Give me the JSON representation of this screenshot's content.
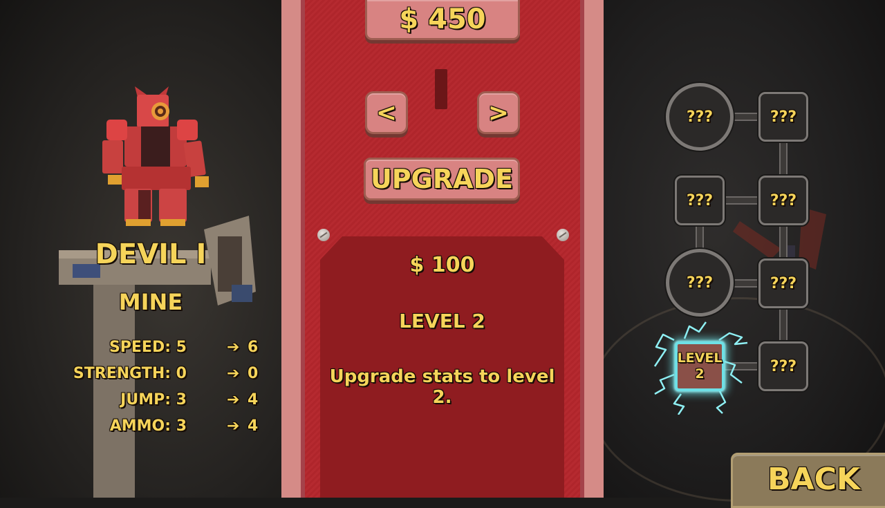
{
  "currency": {
    "balance": "$ 450"
  },
  "robot": {
    "name": "DEVIL I",
    "type": "MINE",
    "stats": [
      {
        "label": "SPEED: 5",
        "arrow": "➔",
        "next": "6"
      },
      {
        "label": "STRENGTH: 0",
        "arrow": "➔",
        "next": "0"
      },
      {
        "label": "JUMP: 3",
        "arrow": "➔",
        "next": "4"
      },
      {
        "label": "AMMO: 3",
        "arrow": "➔",
        "next": "4"
      }
    ]
  },
  "selector": {
    "prev_label": "<",
    "next_label": ">"
  },
  "upgrade_button": {
    "label": "UPGRADE"
  },
  "info": {
    "price": "$ 100",
    "level": "LEVEL 2",
    "description": "Upgrade stats to level 2."
  },
  "tree": {
    "nodes": [
      {
        "label": "???",
        "shape": "circle"
      },
      {
        "label": "???",
        "shape": "square"
      },
      {
        "label": "???",
        "shape": "square"
      },
      {
        "label": "???",
        "shape": "square"
      },
      {
        "label": "???",
        "shape": "circle"
      },
      {
        "label": "???",
        "shape": "square"
      },
      {
        "label_line1": "LEVEL",
        "label_line2": "2",
        "shape": "square",
        "state": "active"
      },
      {
        "label": "???",
        "shape": "square"
      }
    ],
    "active_glow_color": "#6ee0e6"
  },
  "back_button": {
    "label": "BACK"
  },
  "colors": {
    "panel_red": "#b5262c",
    "info_red": "#8f1c20",
    "button_pink": "#d88382",
    "text_gold": "#f6d45a"
  }
}
